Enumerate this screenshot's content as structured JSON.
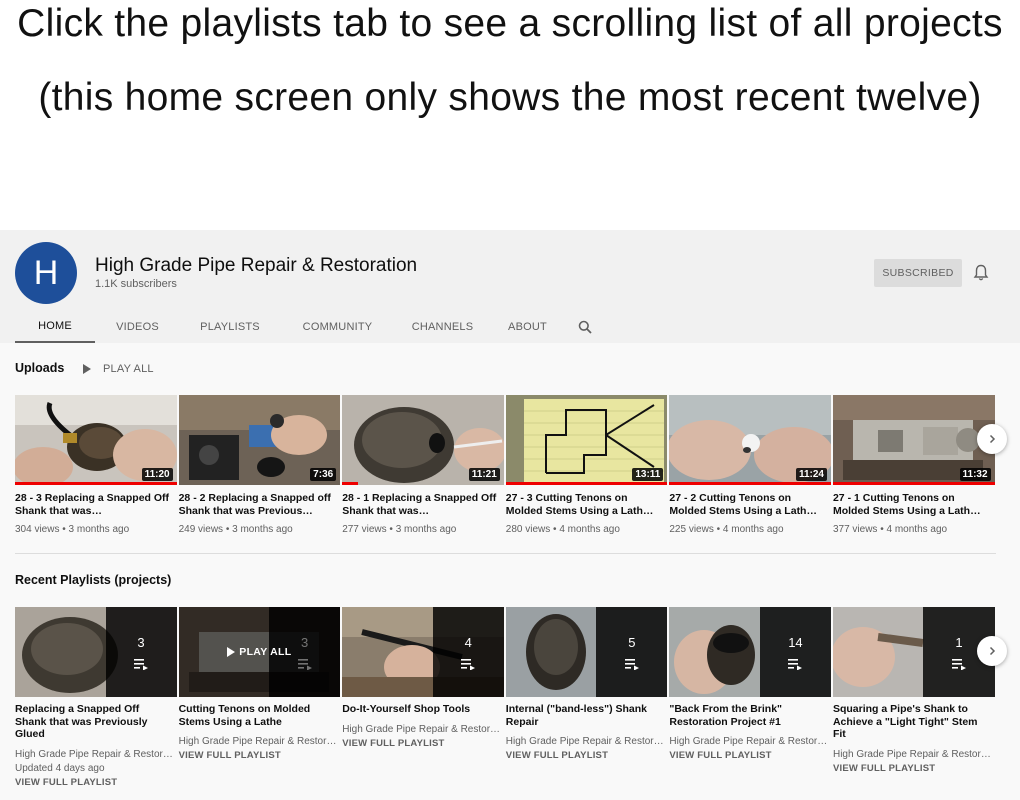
{
  "banner": {
    "line1": "Click the playlists tab to see a scrolling list of all projects",
    "line2": "(this home screen only shows the most recent twelve)"
  },
  "channel": {
    "avatar_letter": "H",
    "name": "High Grade Pipe Repair & Restoration",
    "subscribers": "1.1K subscribers",
    "subscribe_label": "SUBSCRIBED"
  },
  "tabs": [
    "HOME",
    "VIDEOS",
    "PLAYLISTS",
    "COMMUNITY",
    "CHANNELS",
    "ABOUT"
  ],
  "uploads": {
    "title": "Uploads",
    "play_all": "PLAY ALL",
    "videos": [
      {
        "title": "28 - 3 Replacing a Snapped Off Shank that was…",
        "duration": "11:20",
        "views": "304 views",
        "age": "3 months ago",
        "watched": 1.0
      },
      {
        "title": "28 - 2 Replacing a Snapped off Shank that was Previous…",
        "duration": "7:36",
        "views": "249 views",
        "age": "3 months ago",
        "watched": 0.0
      },
      {
        "title": "28 - 1 Replacing a Snapped Off Shank that was…",
        "duration": "11:21",
        "views": "277 views",
        "age": "3 months ago",
        "watched": 0.1
      },
      {
        "title": "27 - 3 Cutting Tenons on Molded Stems Using a Lath…",
        "duration": "13:11",
        "views": "280 views",
        "age": "4 months ago",
        "watched": 1.0
      },
      {
        "title": "27 - 2 Cutting Tenons on Molded Stems Using a Lath…",
        "duration": "11:24",
        "views": "225 views",
        "age": "4 months ago",
        "watched": 1.0
      },
      {
        "title": "27 - 1 Cutting Tenons on Molded Stems Using a Lath…",
        "duration": "11:32",
        "views": "377 views",
        "age": "4 months ago",
        "watched": 1.0
      }
    ]
  },
  "playlists": {
    "title": "Recent Playlists (projects)",
    "hover_label": "PLAY ALL",
    "items": [
      {
        "title": "Replacing a Snapped Off Shank that was Previously Glued",
        "count": "3",
        "channel": "High Grade Pipe Repair & Restorati…",
        "updated": "Updated 4 days ago",
        "view_label": "VIEW FULL PLAYLIST"
      },
      {
        "title": "Cutting Tenons on Molded Stems Using a Lathe",
        "count": "3",
        "channel": "High Grade Pipe Repair & Restorati…",
        "view_label": "VIEW FULL PLAYLIST"
      },
      {
        "title": "Do-It-Yourself Shop Tools",
        "count": "4",
        "channel": "High Grade Pipe Repair & Restorati…",
        "view_label": "VIEW FULL PLAYLIST"
      },
      {
        "title": "Internal (\"band-less\") Shank Repair",
        "count": "5",
        "channel": "High Grade Pipe Repair & Restorati…",
        "view_label": "VIEW FULL PLAYLIST"
      },
      {
        "title": "\"Back From the Brink\" Restoration Project #1",
        "count": "14",
        "channel": "High Grade Pipe Repair & Restorati…",
        "view_label": "VIEW FULL PLAYLIST"
      },
      {
        "title": "Squaring a Pipe's Shank to Achieve a \"Light Tight\" Stem Fit",
        "count": "1",
        "channel": "High Grade Pipe Repair & Restorati…",
        "view_label": "VIEW FULL PLAYLIST"
      }
    ]
  }
}
